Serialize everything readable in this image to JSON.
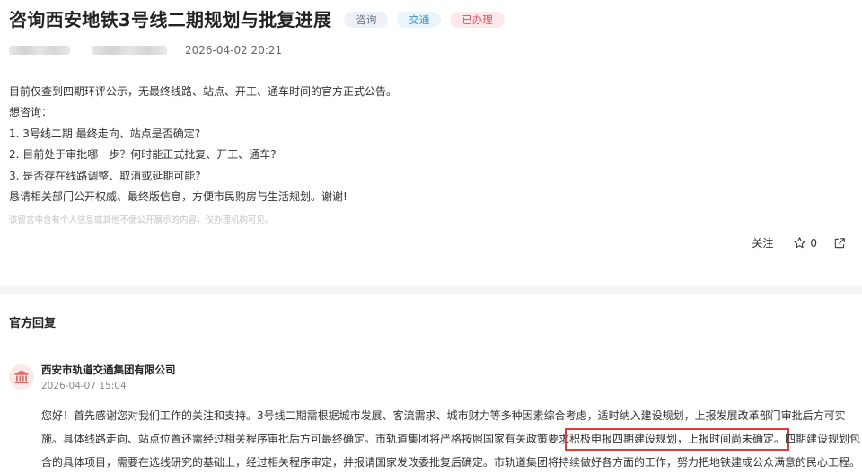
{
  "question": {
    "title": "咨询西安地铁3号线二期规划与批复进展",
    "tags": [
      {
        "label": "咨询",
        "color": "#6a7489"
      },
      {
        "label": "交通",
        "color": "#3a93c4"
      },
      {
        "label": "已办理",
        "color": "#e5525a"
      }
    ],
    "date": "2026-04-02 20:21",
    "body_lines": [
      "目前仅查到四期环评公示，无最终线路、站点、开工、通车时间的官方正式公告。",
      "想咨询：",
      "1. 3号线二期 最终走向、站点是否确定?",
      "2. 目前处于审批哪一步？何时能正式批复、开工、通车?",
      "3. 是否存在线路调整、取消或延期可能?",
      "恳请相关部门公开权威、最终版信息，方便市民购房与生活规划。谢谢!"
    ],
    "notice": "该留言中含有个人信息或其他不便公开展示的内容，仅办理机构可见。"
  },
  "actions": {
    "follow_label": "关注",
    "like_count": "0",
    "star_icon": "star-icon",
    "share_icon": "share-icon"
  },
  "reply": {
    "heading": "官方回复",
    "org_name": "西安市轨道交通集团有限公司",
    "org_icon": "government-building-icon",
    "date": "2026-04-07 15:04",
    "line1": "您好！首先感谢您对我们工作的关注和支持。3号线二期需根据城市发展、客流需求、城市财力等多种因素综合考虑，适时纳入建设规划，上报发展改革部门审批后方可实",
    "line2_before": "施。具体线路走向、站点位置还需经过相关程序审批后方可最终确定。市轨道集团将严格按照国家有关政策要求",
    "line2_highlight": "积极申报四期建设规划，上报时间尚未确定。",
    "line2_after": "四期建设规划包",
    "line3": "含的具体项目，需要在选线研究的基础上，经过相关程序审定，并报请国家发改委批复后确定。市轨道集团将持续做好各方面的工作，努力把地铁建成公众满意的民心工程。",
    "highlight_color": "#e23c3c"
  }
}
